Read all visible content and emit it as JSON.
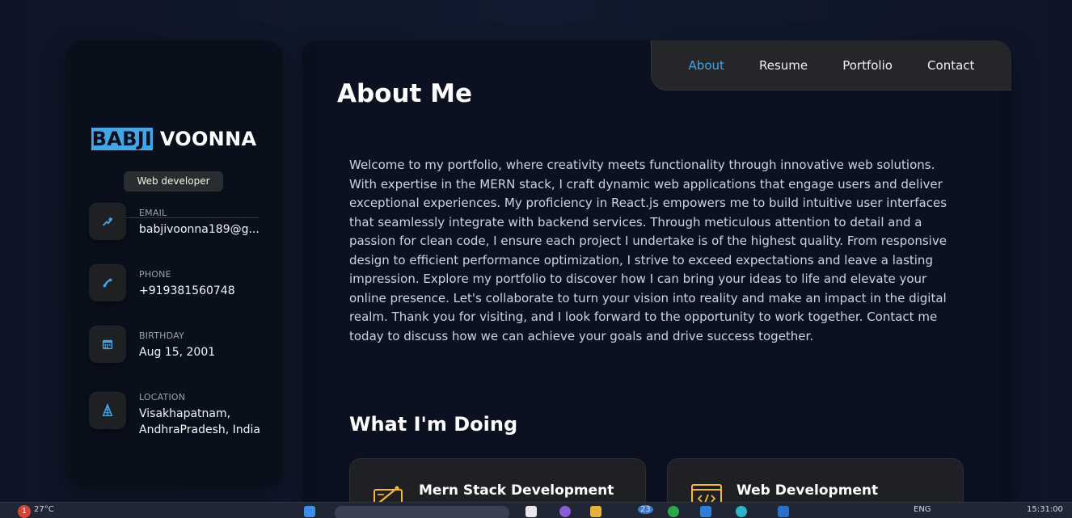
{
  "profile": {
    "first_name": "BABJI",
    "last_name": "VOONNA",
    "role": "Web developer"
  },
  "contacts": [
    {
      "label": "EMAIL",
      "value": "babjivoonna189@g...",
      "icon": "mail-icon"
    },
    {
      "label": "PHONE",
      "value": "+919381560748",
      "icon": "phone-icon"
    },
    {
      "label": "BIRTHDAY",
      "value": "Aug 15, 2001",
      "icon": "calendar-icon"
    },
    {
      "label": "LOCATION",
      "value": "Visakhapatnam, AndhraPradesh, India",
      "icon": "location-icon"
    }
  ],
  "nav": {
    "items": [
      "About",
      "Resume",
      "Portfolio",
      "Contact"
    ],
    "active": "About"
  },
  "about": {
    "title": "About Me",
    "text": "Welcome to my portfolio, where creativity meets functionality through innovative web solutions. With expertise in the MERN stack, I craft dynamic web applications that engage users and deliver exceptional experiences. My proficiency in React.js empowers me to build intuitive user interfaces that seamlessly integrate with backend services. Through meticulous attention to detail and a passion for clean code, I ensure each project I undertake is of the highest quality. From responsive design to efficient performance optimization, I strive to exceed expectations and leave a lasting impression. Explore my portfolio to discover how I can bring your ideas to life and elevate your online presence. Let's collaborate to turn your vision into reality and make an impact in the digital realm. Thank you for visiting, and I look forward to the opportunity to work together. Contact me today to discuss how we can achieve your goals and drive success together."
  },
  "doing": {
    "title": "What I'm Doing",
    "services": [
      {
        "title": "Mern Stack Development",
        "icon": "design-icon"
      },
      {
        "title": "Web Development",
        "icon": "code-window-icon"
      }
    ]
  },
  "taskbar": {
    "weather": "27°C",
    "notification_count": "1",
    "badge": "23",
    "language": "ENG",
    "time": "15:31:00"
  },
  "colors": {
    "accent": "#44a6e8",
    "panel": "#0a0f1c",
    "background": "#0f1629",
    "icon_gold": "#f5b83d"
  }
}
